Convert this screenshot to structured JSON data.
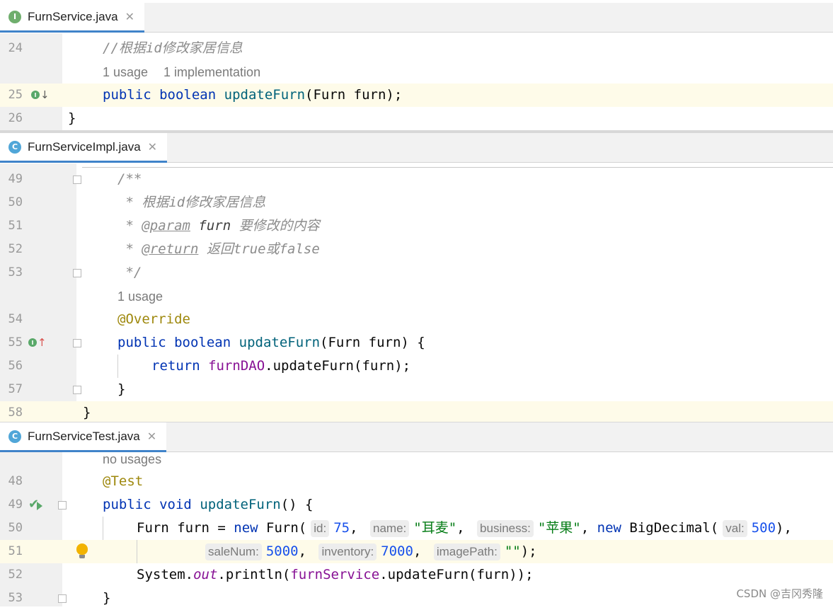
{
  "panes": [
    {
      "tab": {
        "name": "FurnService.java",
        "icon_letter": "I",
        "icon_color": "#6fae6d"
      },
      "lines": {
        "l24": {
          "num": "24",
          "comment": "//根据id修改家居信息"
        },
        "hints": {
          "usage": "1 usage",
          "impl": "1 implementation"
        },
        "l25": {
          "num": "25",
          "kw1": "public",
          "kw2": "boolean",
          "fn": "updateFurn",
          "rest": "(Furn furn);"
        },
        "l26": {
          "num": "26",
          "text": "}"
        }
      }
    },
    {
      "tab": {
        "name": "FurnServiceImpl.java",
        "icon_letter": "C",
        "icon_color": "#50a6d8"
      },
      "lines": {
        "l49": {
          "num": "49",
          "text": "/**"
        },
        "l50": {
          "num": "50",
          "text": " * 根据id修改家居信息"
        },
        "l51": {
          "num": "51",
          "star": " * ",
          "tag": "@param",
          "param": "furn",
          "desc": " 要修改的内容"
        },
        "l52": {
          "num": "52",
          "star": " * ",
          "tag": "@return",
          "desc": " 返回true或false"
        },
        "l53": {
          "num": "53",
          "text": " */"
        },
        "hint": "1 usage",
        "l54": {
          "num": "54",
          "text": "@Override"
        },
        "l55": {
          "num": "55",
          "kw1": "public",
          "kw2": "boolean",
          "fn": "updateFurn",
          "rest": "(Furn furn) {"
        },
        "l56": {
          "num": "56",
          "kw": "return",
          "fld": "furnDAO",
          "rest": ".updateFurn(furn);"
        },
        "l57": {
          "num": "57",
          "text": "}"
        },
        "l58": {
          "num": "58",
          "text": "}"
        }
      }
    },
    {
      "tab": {
        "name": "FurnServiceTest.java",
        "icon_letter": "C",
        "icon_color": "#50a6d8"
      },
      "lines": {
        "hint": "no usages",
        "l48": {
          "num": "48",
          "text": "@Test"
        },
        "l49": {
          "num": "49",
          "kw1": "public",
          "kw2": "void",
          "fn": "updateFurn",
          "rest": "() {"
        },
        "l50": {
          "num": "50",
          "p1": "Furn furn = ",
          "kw": "new",
          "p2": " Furn(",
          "h_id": "id:",
          "v_id": "75",
          "h_name": "name:",
          "v_name": "\"耳麦\"",
          "h_business": "business:",
          "v_business": "\"苹果\"",
          "kw_new2": "new",
          "p3": " BigDecimal(",
          "h_val": "val:",
          "v_val": "500",
          "p4": "),"
        },
        "l51": {
          "num": "51",
          "h_saleNum": "saleNum:",
          "v_saleNum": "5000",
          "h_inventory": "inventory:",
          "v_inventory": "7000",
          "h_imagePath": "imagePath:",
          "v_imagePath": "\"\"",
          "tail": ");"
        },
        "l52": {
          "num": "52",
          "p1": "System.",
          "fld": "out",
          "p2": ".println(",
          "fld2": "furnService",
          "p3": ".updateFurn(furn));"
        },
        "l53": {
          "num": "53",
          "text": "}"
        }
      }
    }
  ],
  "watermark": "CSDN @吉冈秀隆"
}
